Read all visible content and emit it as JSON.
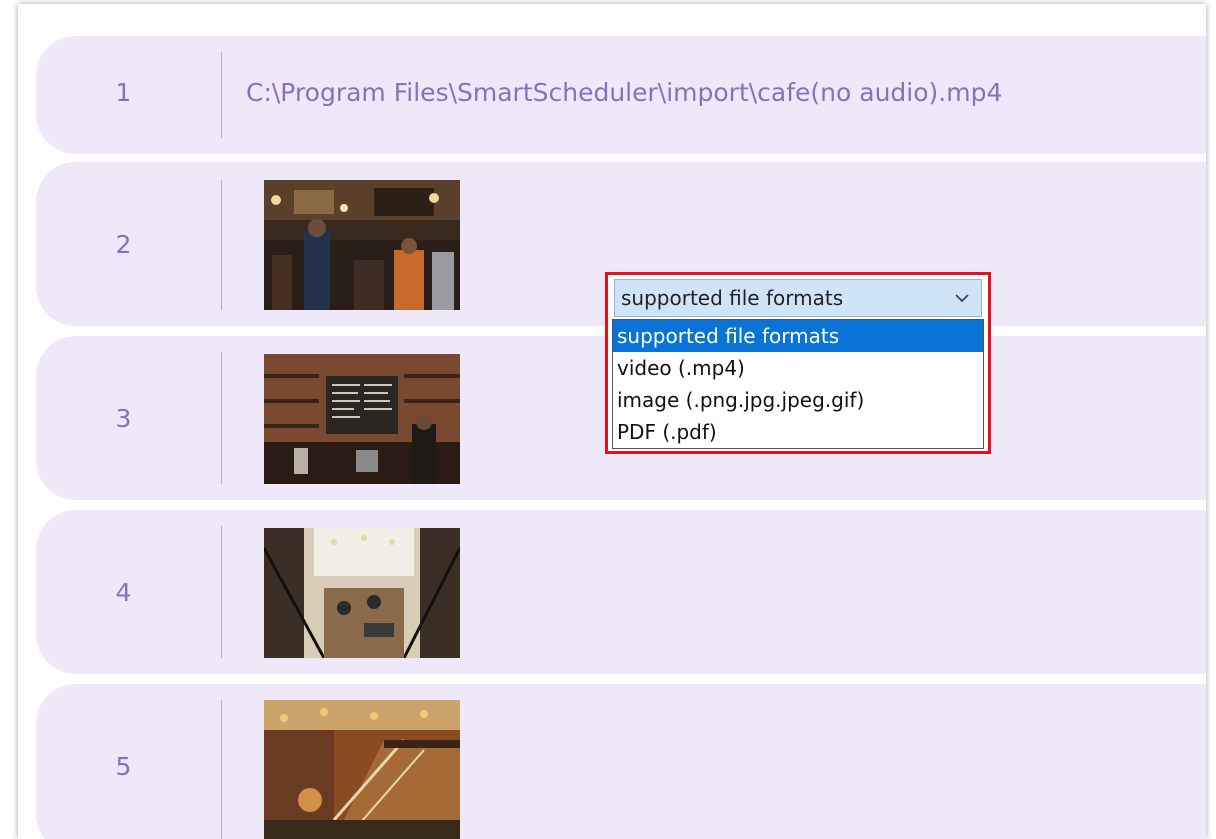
{
  "rows": [
    {
      "index": "1",
      "content": "C:\\Program Files\\SmartScheduler\\import\\cafe(no audio).mp4"
    },
    {
      "index": "2",
      "thumbnail": "cafe-crowd-photo"
    },
    {
      "index": "3",
      "thumbnail": "cafe-counter-menu-photo"
    },
    {
      "index": "4",
      "thumbnail": "cafe-top-down-photo"
    },
    {
      "index": "5",
      "thumbnail": "cafe-staircase-photo"
    }
  ],
  "format_select": {
    "selected": "supported file formats",
    "options": [
      "supported file formats",
      "video (.mp4)",
      "image (.png.jpg.jpeg.gif)",
      "PDF (.pdf)"
    ],
    "highlight_color": "#e5121b",
    "active_option_color": "#0a73d8"
  },
  "colors": {
    "row_bg": "#efe8f8",
    "row_text": "#8a6fc1"
  }
}
